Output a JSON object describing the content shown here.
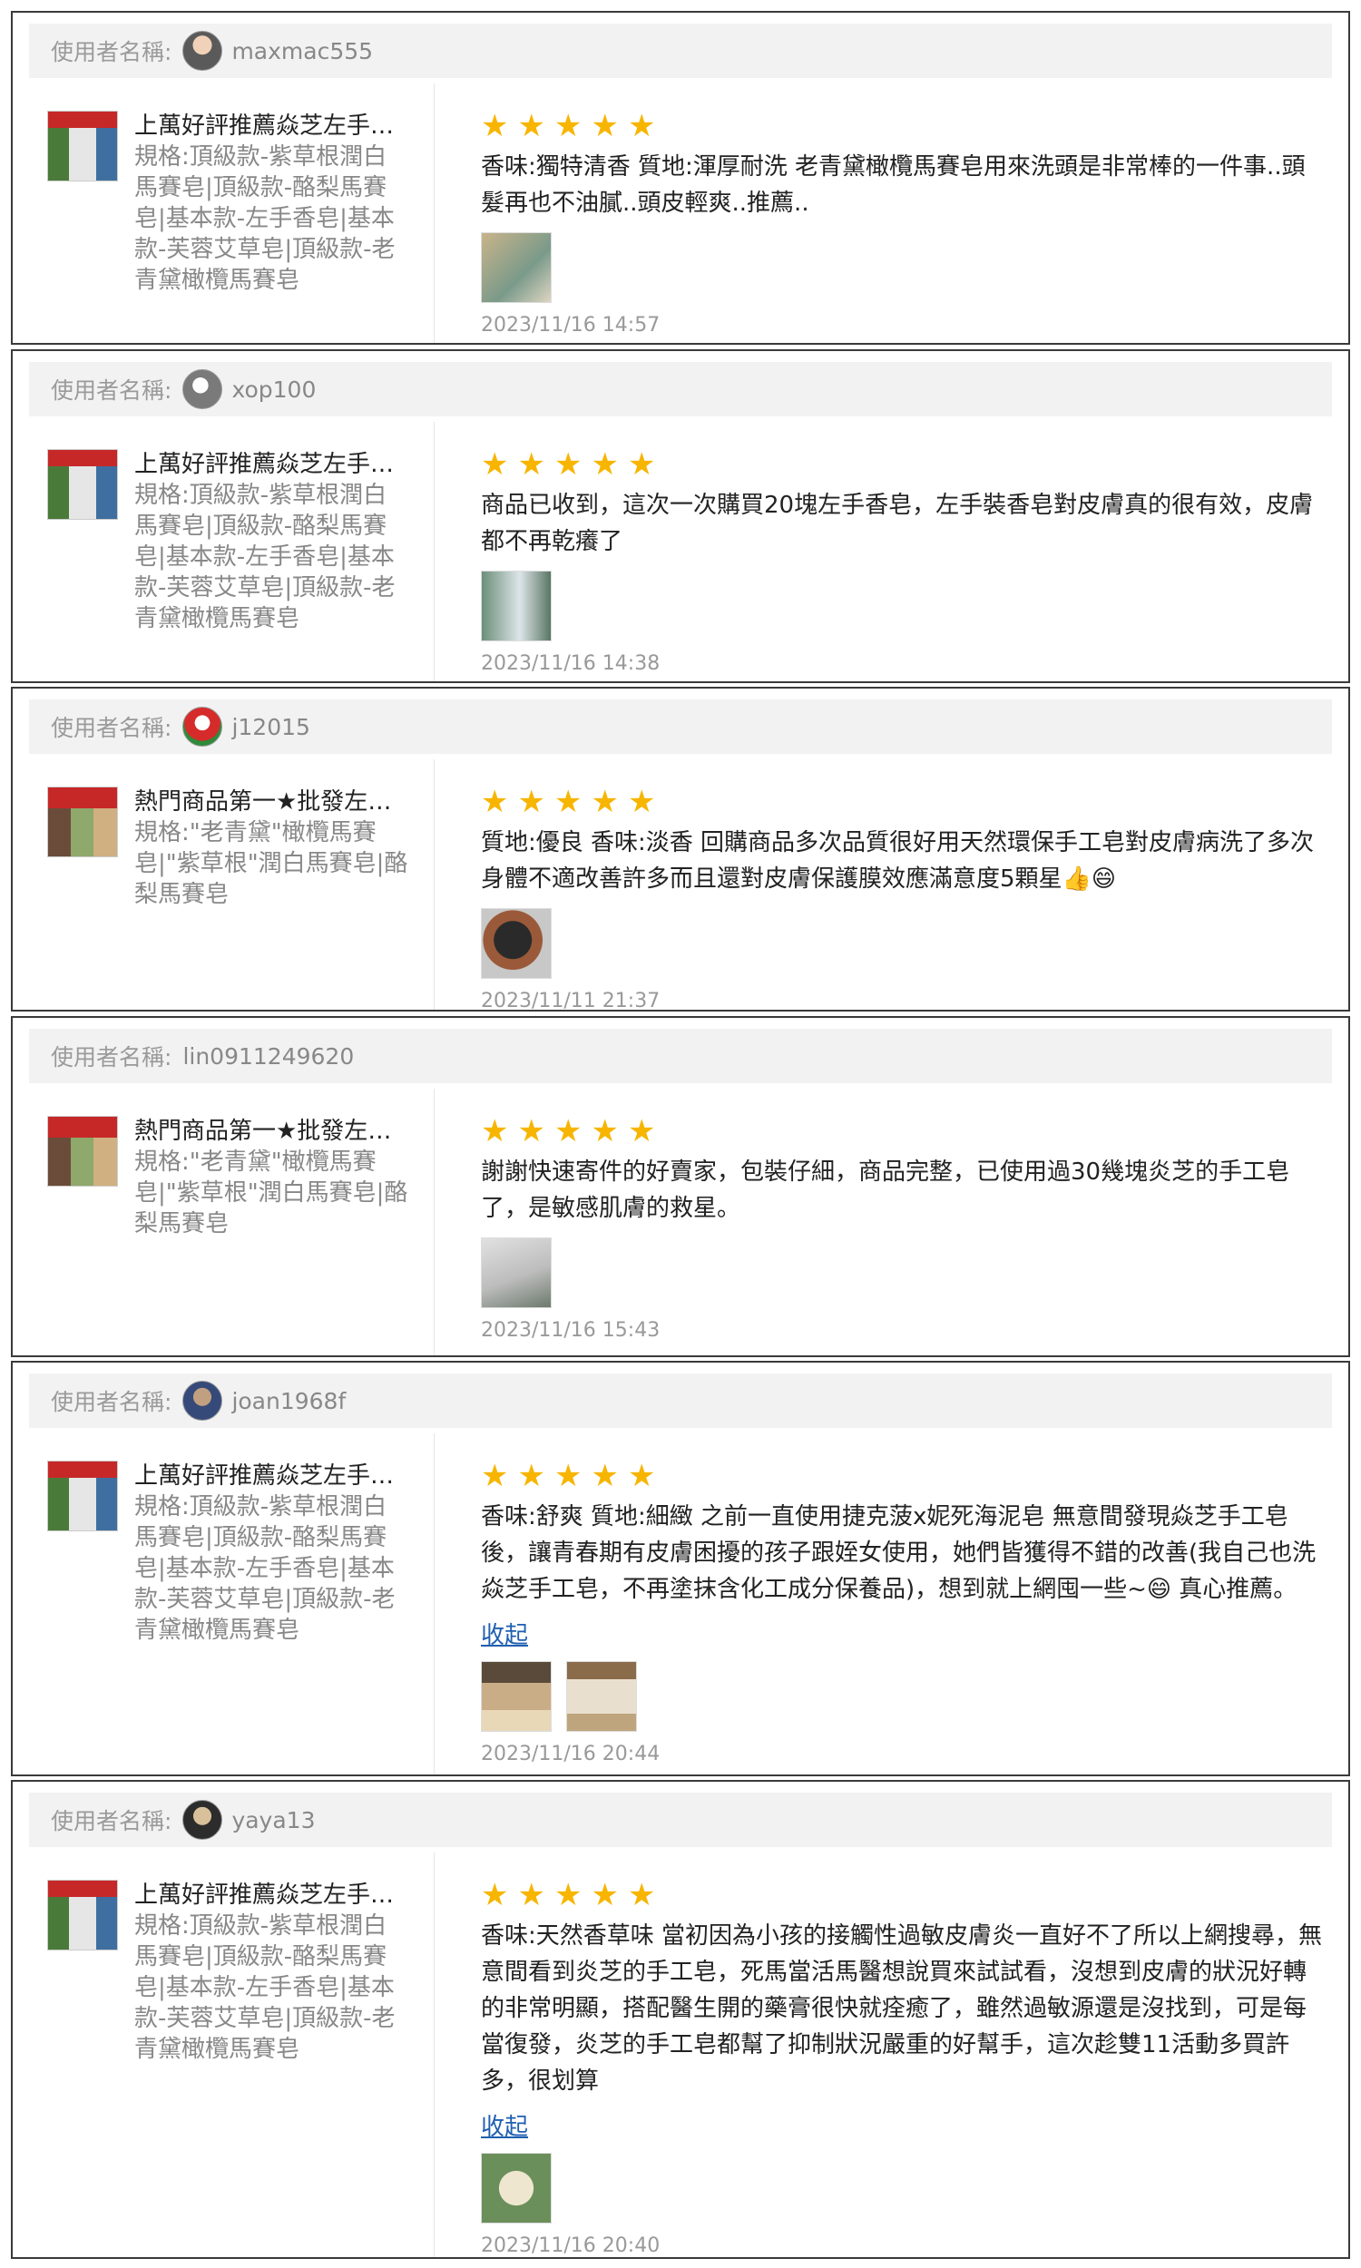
{
  "user_label": "使用者名稱:",
  "collapse_label": "收起",
  "reviews": [
    {
      "username": "maxmac555",
      "product_name": "上萬好評推薦焱芝左手香皂",
      "product_spec": "規格:頂級款-紫草根潤白馬賽皂|頂級款-酪梨馬賽皂|基本款-左手香皂|基本款-芙蓉艾草皂|頂級款-老青黛橄欖馬賽皂",
      "stars": 5,
      "text": "香味:獨特清香 質地:渾厚耐洗 老青黛橄欖馬賽皂用來洗頭是非常棒的一件事..頭髮再也不油膩..頭皮輕爽..推薦..",
      "photos": 1,
      "timestamp": "2023/11/16 14:57"
    },
    {
      "username": "xop100",
      "product_name": "上萬好評推薦焱芝左手香皂",
      "product_spec": "規格:頂級款-紫草根潤白馬賽皂|頂級款-酪梨馬賽皂|基本款-左手香皂|基本款-芙蓉艾草皂|頂級款-老青黛橄欖馬賽皂",
      "stars": 5,
      "text": "商品已收到，這次一次購買20塊左手香皂，左手裝香皂對皮膚真的很有效，皮膚都不再乾癢了",
      "photos": 1,
      "timestamp": "2023/11/16 14:38"
    },
    {
      "username": "j12015",
      "product_name": "熱門商品第一★批發左手香皂",
      "product_spec": "規格:\"老青黛\"橄欖馬賽皂|\"紫草根\"潤白馬賽皂|酪梨馬賽皂",
      "stars": 5,
      "text": "質地:優良 香味:淡香 回購商品多次品質很好用天然環保手工皂對皮膚病洗了多次身體不適改善許多而且還對皮膚保護膜效應滿意度5顆星👍😄",
      "photos": 1,
      "timestamp": "2023/11/11 21:37"
    },
    {
      "username": "lin0911249620",
      "product_name": "熱門商品第一★批發左手香皂",
      "product_spec": "規格:\"老青黛\"橄欖馬賽皂|\"紫草根\"潤白馬賽皂|酪梨馬賽皂",
      "stars": 5,
      "text": "謝謝快速寄件的好賣家，包裝仔細，商品完整，已使用過30幾塊炎芝的手工皂了，是敏感肌膚的救星。",
      "photos": 1,
      "timestamp": "2023/11/16 15:43"
    },
    {
      "username": "joan1968f",
      "product_name": "上萬好評推薦焱芝左手香皂",
      "product_spec": "規格:頂級款-紫草根潤白馬賽皂|頂級款-酪梨馬賽皂|基本款-左手香皂|基本款-芙蓉艾草皂|頂級款-老青黛橄欖馬賽皂",
      "stars": 5,
      "text": "香味:舒爽 質地:細緻 之前一直使用捷克菠x妮死海泥皂 無意間發現焱芝手工皂後，讓青春期有皮膚困擾的孩子跟姪女使用，她們皆獲得不錯的改善(我自己也洗焱芝手工皂，不再塗抹含化工成分保養品)，想到就上網囤一些~😄 真心推薦。",
      "photos": 2,
      "timestamp": "2023/11/16 20:44"
    },
    {
      "username": "yaya13",
      "product_name": "上萬好評推薦焱芝左手香皂",
      "product_spec": "規格:頂級款-紫草根潤白馬賽皂|頂級款-酪梨馬賽皂|基本款-左手香皂|基本款-芙蓉艾草皂|頂級款-老青黛橄欖馬賽皂",
      "stars": 5,
      "text": "香味:天然香草味 當初因為小孩的接觸性過敏皮膚炎一直好不了所以上網搜尋，無意間看到炎芝的手工皂，死馬當活馬醫想說買來試試看，沒想到皮膚的狀況好轉的非常明顯，搭配醫生開的藥膏很快就痊癒了，雖然過敏源還是沒找到，可是每當復發，炎芝的手工皂都幫了抑制狀況嚴重的好幫手，這次趁雙11活動多買許多，很划算",
      "photos": 1,
      "timestamp": "2023/11/16 20:40"
    }
  ]
}
